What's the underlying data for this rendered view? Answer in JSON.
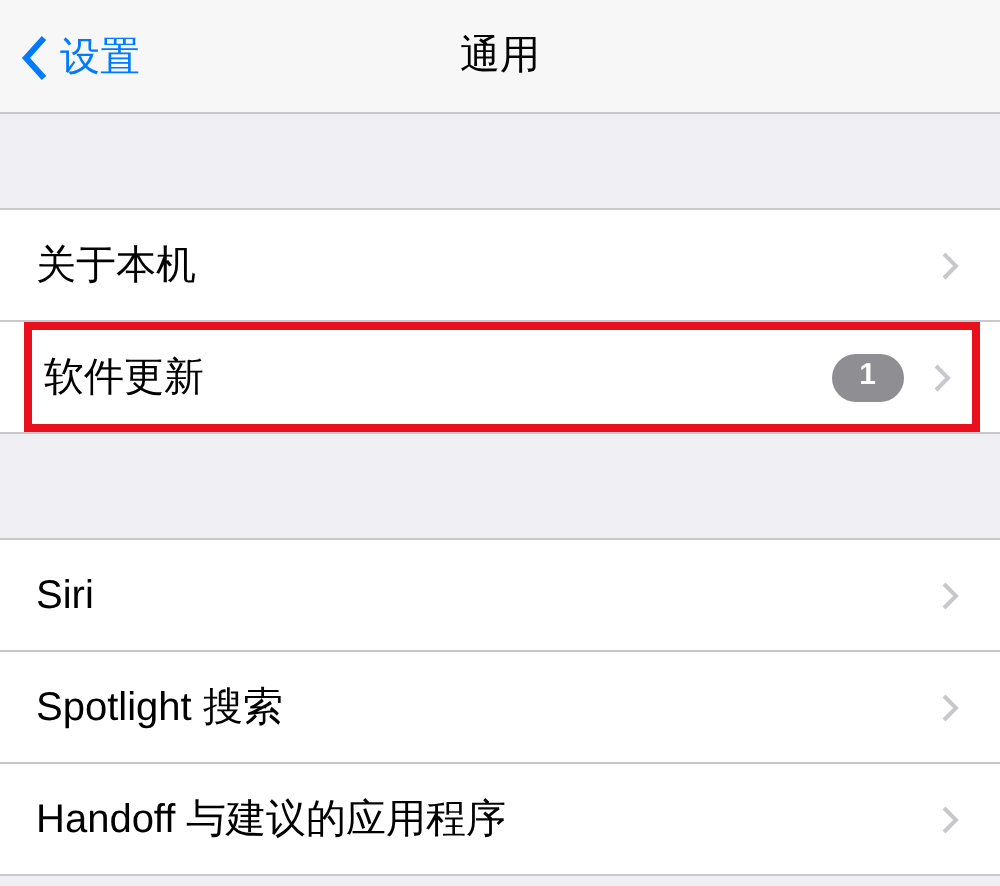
{
  "nav": {
    "back_label": "设置",
    "title": "通用"
  },
  "groups": [
    {
      "rows": [
        {
          "label": "关于本机",
          "highlighted": false
        },
        {
          "label": "软件更新",
          "badge": "1",
          "highlighted": true
        }
      ]
    },
    {
      "rows": [
        {
          "label": "Siri",
          "highlighted": false
        },
        {
          "label": "Spotlight 搜索",
          "highlighted": false
        },
        {
          "label": "Handoff 与建议的应用程序",
          "highlighted": false
        }
      ]
    }
  ]
}
